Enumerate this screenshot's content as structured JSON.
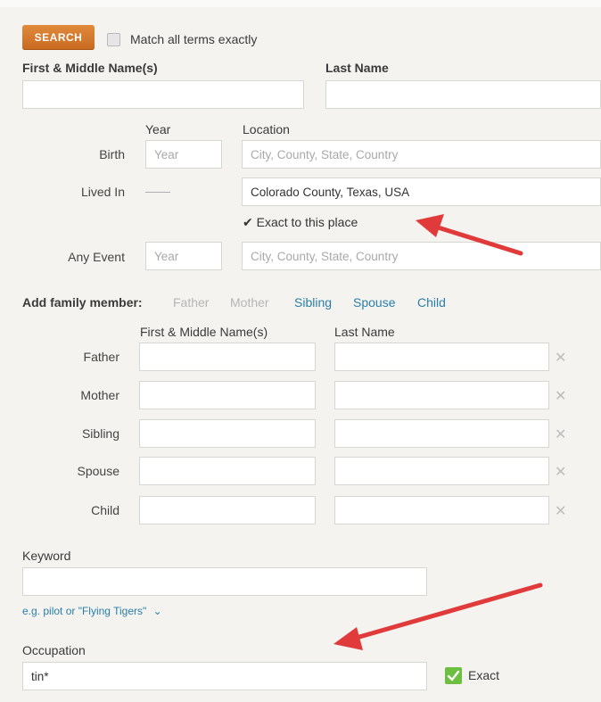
{
  "search": {
    "button_label": "SEARCH",
    "match_label": "Match all terms exactly"
  },
  "name": {
    "first_label": "First & Middle Name(s)",
    "last_label": "Last Name",
    "first_value": "",
    "last_value": ""
  },
  "events": {
    "year_header": "Year",
    "location_header": "Location",
    "birth": {
      "label": "Birth",
      "year_placeholder": "Year",
      "location_placeholder": "City, County, State, Country"
    },
    "lived_in": {
      "label": "Lived In",
      "year_dash": "——",
      "location_value": "Colorado County, Texas, USA",
      "exact_label": "✔ Exact to this place"
    },
    "any_event": {
      "label": "Any Event",
      "year_placeholder": "Year",
      "location_placeholder": "City, County, State, Country"
    }
  },
  "family": {
    "add_label": "Add family member:",
    "links": [
      {
        "label": "Father",
        "state": "disabled"
      },
      {
        "label": "Mother",
        "state": "disabled"
      },
      {
        "label": "Sibling",
        "state": "active"
      },
      {
        "label": "Spouse",
        "state": "active"
      },
      {
        "label": "Child",
        "state": "active"
      }
    ],
    "first_header": "First & Middle Name(s)",
    "last_header": "Last Name",
    "rows": [
      {
        "label": "Father"
      },
      {
        "label": "Mother"
      },
      {
        "label": "Sibling"
      },
      {
        "label": "Spouse"
      },
      {
        "label": "Child"
      }
    ],
    "remove_glyph": "✕"
  },
  "keyword": {
    "label": "Keyword",
    "value": "",
    "hint": "e.g. pilot or \"Flying Tigers\"",
    "hint_chevron": "⌄"
  },
  "occupation": {
    "label": "Occupation",
    "value": "tin*",
    "exact_label": "Exact",
    "exact_checked": true
  },
  "colors": {
    "accent_orange": "#d4782b",
    "link_blue": "#2a7fa8",
    "arrow_red": "#e03a3a",
    "check_green": "#6cbf3f"
  }
}
